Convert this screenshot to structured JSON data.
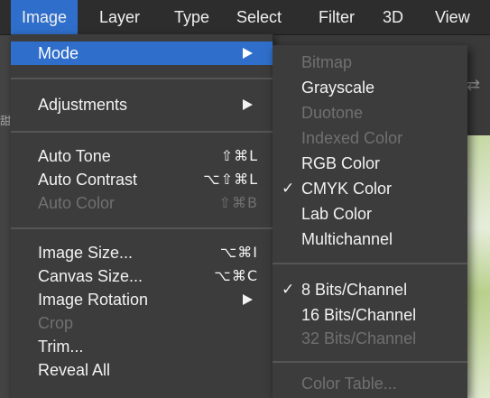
{
  "menubar": {
    "items": [
      {
        "label": "Image",
        "active": true
      },
      {
        "label": "Layer"
      },
      {
        "label": "Type"
      },
      {
        "label": "Select"
      },
      {
        "label": "Filter"
      },
      {
        "label": "3D"
      },
      {
        "label": "View"
      }
    ]
  },
  "image_menu": {
    "items": [
      {
        "label": "Mode",
        "submenu": true,
        "highlighted": true
      },
      {
        "label": "Adjustments",
        "submenu": true
      },
      {
        "label": "Auto Tone",
        "shortcut": "⇧⌘L"
      },
      {
        "label": "Auto Contrast",
        "shortcut": "⌥⇧⌘L"
      },
      {
        "label": "Auto Color",
        "shortcut": "⇧⌘B",
        "disabled": true
      },
      {
        "label": "Image Size...",
        "shortcut": "⌥⌘I"
      },
      {
        "label": "Canvas Size...",
        "shortcut": "⌥⌘C"
      },
      {
        "label": "Image Rotation",
        "submenu": true
      },
      {
        "label": "Crop",
        "disabled": true
      },
      {
        "label": "Trim..."
      },
      {
        "label": "Reveal All"
      }
    ]
  },
  "mode_submenu": {
    "items": [
      {
        "label": "Bitmap",
        "disabled": true
      },
      {
        "label": "Grayscale"
      },
      {
        "label": "Duotone",
        "disabled": true
      },
      {
        "label": "Indexed Color",
        "disabled": true
      },
      {
        "label": "RGB Color"
      },
      {
        "label": "CMYK Color",
        "checked": true
      },
      {
        "label": "Lab Color"
      },
      {
        "label": "Multichannel"
      },
      {
        "label": "8 Bits/Channel",
        "checked": true
      },
      {
        "label": "16 Bits/Channel"
      },
      {
        "label": "32 Bits/Channel",
        "disabled": true
      },
      {
        "label": "Color Table...",
        "disabled": true
      }
    ],
    "check_glyph": "✓"
  },
  "colors": {
    "highlight": "#2f6fcb",
    "menu_bg": "#3c3c3c",
    "text": "#f2f2f2",
    "disabled_text": "#707070"
  }
}
